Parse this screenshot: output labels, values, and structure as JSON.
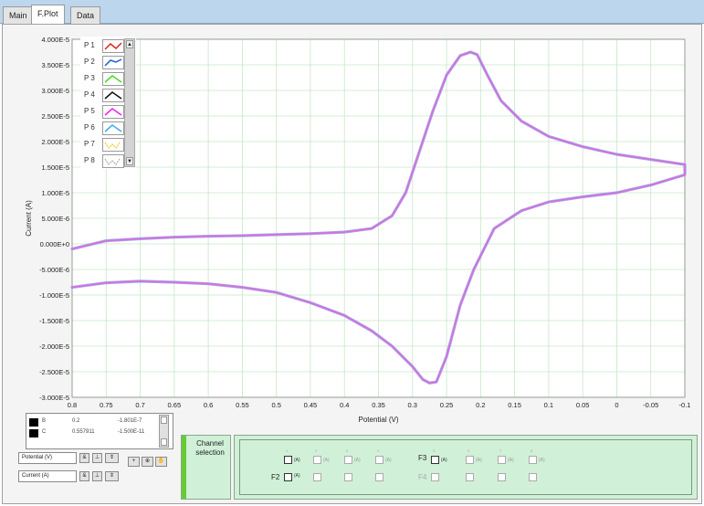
{
  "tabs": [
    {
      "label": "Main",
      "active": false
    },
    {
      "label": "F.Plot",
      "active": true
    },
    {
      "label": "Data",
      "active": false
    }
  ],
  "chart_data": {
    "type": "line",
    "title": "",
    "xlabel": "Potential (V)",
    "ylabel": "Current (A)",
    "xlim": [
      0.8,
      -0.1
    ],
    "ylim": [
      -3e-05,
      4e-05
    ],
    "x_reversed": true,
    "grid": true,
    "grid_color": "#c6e6c6",
    "x_ticks": [
      "0.8",
      "0.75",
      "0.7",
      "0.65",
      "0.6",
      "0.55",
      "0.5",
      "0.45",
      "0.4",
      "0.35",
      "0.3",
      "0.25",
      "0.2",
      "0.15",
      "0.1",
      "0.05",
      "0",
      "-0.05",
      "-0.1"
    ],
    "y_ticks": [
      "4.000E-5",
      "3.500E-5",
      "3.000E-5",
      "2.500E-5",
      "2.000E-5",
      "1.500E-5",
      "1.000E-5",
      "5.000E-6",
      "0.000E+0",
      "-5.000E-6",
      "-1.000E-5",
      "-1.500E-5",
      "-2.000E-5",
      "-2.500E-5",
      "-3.000E-5"
    ],
    "legend": {
      "placement": "top-left",
      "entries": [
        {
          "label": "P 1",
          "color": "#e02020",
          "dashed": false
        },
        {
          "label": "P 2",
          "color": "#1a5fd0",
          "dashed": false
        },
        {
          "label": "P 3",
          "color": "#44dd22",
          "dashed": false
        },
        {
          "label": "P 4",
          "color": "#111111",
          "dashed": false
        },
        {
          "label": "P 5",
          "color": "#ee22ee",
          "dashed": false
        },
        {
          "label": "P 6",
          "color": "#44aaee",
          "dashed": false
        },
        {
          "label": "P 7",
          "color": "#eecc22",
          "dashed": true
        },
        {
          "label": "P 8",
          "color": "#aaaaaa",
          "dashed": true
        }
      ]
    },
    "series": [
      {
        "color": "#d472d8",
        "shadow_color": "#9a9ef0",
        "x": [
          0.8,
          0.75,
          0.7,
          0.65,
          0.6,
          0.55,
          0.5,
          0.45,
          0.4,
          0.36,
          0.33,
          0.31,
          0.29,
          0.27,
          0.25,
          0.23,
          0.215,
          0.205,
          0.19,
          0.17,
          0.14,
          0.1,
          0.05,
          0.0,
          -0.05,
          -0.1,
          -0.1,
          -0.05,
          0.0,
          0.05,
          0.1,
          0.14,
          0.18,
          0.21,
          0.23,
          0.25,
          0.265,
          0.275,
          0.285,
          0.3,
          0.33,
          0.36,
          0.4,
          0.45,
          0.5,
          0.55,
          0.6,
          0.65,
          0.7,
          0.75,
          0.8
        ],
        "y": [
          -1e-06,
          6e-07,
          1e-06,
          1.3e-06,
          1.5e-06,
          1.6e-06,
          1.8e-06,
          2e-06,
          2.3e-06,
          3e-06,
          5.5e-06,
          1e-05,
          1.8e-05,
          2.6e-05,
          3.3e-05,
          3.68e-05,
          3.75e-05,
          3.7e-05,
          3.3e-05,
          2.8e-05,
          2.4e-05,
          2.1e-05,
          1.9e-05,
          1.75e-05,
          1.65e-05,
          1.55e-05,
          1.35e-05,
          1.15e-05,
          1e-05,
          9.2e-06,
          8.2e-06,
          6.5e-06,
          3e-06,
          -5e-06,
          -1.2e-05,
          -2.2e-05,
          -2.7e-05,
          -2.72e-05,
          -2.65e-05,
          -2.4e-05,
          -2e-05,
          -1.7e-05,
          -1.4e-05,
          -1.15e-05,
          -9.5e-06,
          -8.5e-06,
          -7.8e-06,
          -7.5e-06,
          -7.3e-06,
          -7.6e-06,
          -8.5e-06
        ]
      }
    ]
  },
  "cursor_table": {
    "rows": [
      {
        "name": "B",
        "x": "0.2",
        "y": "-1.801E-7"
      },
      {
        "name": "C",
        "x": "0.557911",
        "y": "-1.500E-11"
      }
    ]
  },
  "axis_controls": {
    "x_label": "Potential (V)",
    "y_label": "Current (A)"
  },
  "channel": {
    "button_label": "Channel selection",
    "unit": "(A)",
    "f2_label": "F2",
    "f3_label": "F3",
    "f4_label": "F4",
    "f5_label": "F5"
  }
}
